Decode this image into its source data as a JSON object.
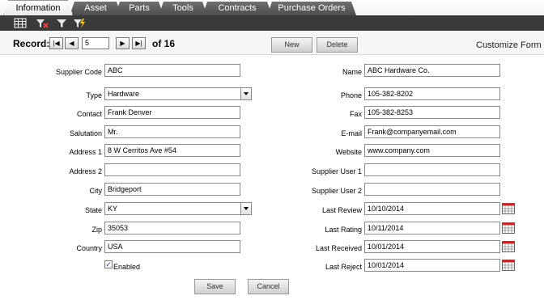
{
  "tabs": [
    "Information",
    "Asset",
    "Parts",
    "Tools",
    "Contracts",
    "Purchase Orders"
  ],
  "toolbar": {
    "icons": [
      "grid-icon",
      "filter-clear-icon",
      "filter-icon",
      "filter-apply-icon"
    ]
  },
  "record": {
    "label": "Record:",
    "current": "5",
    "of_text": "of 16",
    "new_label": "New",
    "delete_label": "Delete",
    "customize_label": "Customize Form"
  },
  "left": {
    "supplier_code": {
      "label": "Supplier Code",
      "value": "ABC"
    },
    "type": {
      "label": "Type",
      "value": "Hardware"
    },
    "contact": {
      "label": "Contact",
      "value": "Frank Denver"
    },
    "salutation": {
      "label": "Salutation",
      "value": "Mr."
    },
    "address1": {
      "label": "Address 1",
      "value": "8 W Cerritos Ave #54"
    },
    "address2": {
      "label": "Address 2",
      "value": ""
    },
    "city": {
      "label": "City",
      "value": "Bridgeport"
    },
    "state": {
      "label": "State",
      "value": "KY"
    },
    "zip": {
      "label": "Zip",
      "value": "35053"
    },
    "country": {
      "label": "Country",
      "value": "USA"
    },
    "enabled": {
      "label": "Enabled",
      "checked": true
    }
  },
  "right": {
    "name": {
      "label": "Name",
      "value": "ABC Hardware Co."
    },
    "phone": {
      "label": "Phone",
      "value": "105-382-8202"
    },
    "fax": {
      "label": "Fax",
      "value": "105-382-8253"
    },
    "email": {
      "label": "E-mail",
      "value": "Frank@companyemail.com"
    },
    "website": {
      "label": "Website",
      "value": "www.company.com"
    },
    "supplier_user1": {
      "label": "Supplier User 1",
      "value": ""
    },
    "supplier_user2": {
      "label": "Supplier User 2",
      "value": ""
    },
    "last_review": {
      "label": "Last Review",
      "value": "10/10/2014"
    },
    "last_rating": {
      "label": "Last Rating",
      "value": "10/11/2014"
    },
    "last_received": {
      "label": "Last Received",
      "value": "10/01/2014"
    },
    "last_reject": {
      "label": "Last Reject",
      "value": "10/01/2014"
    }
  },
  "actions": {
    "save_label": "Save",
    "cancel_label": "Cancel"
  },
  "colors": {
    "tab_dark": "#5a5a5a",
    "toolbar": "#3a3a3a",
    "calendar_accent": "#cc2222"
  }
}
